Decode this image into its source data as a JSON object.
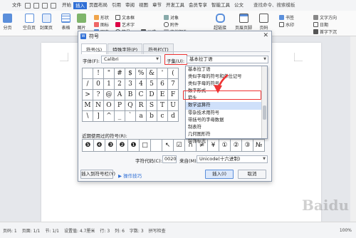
{
  "menubar": {
    "file": "文件",
    "items": [
      "开始",
      "插入",
      "页面布局",
      "引用",
      "审阅",
      "视图",
      "章节",
      "开发工具",
      "会员专享",
      "智能工具",
      "公文"
    ],
    "active_index": 1,
    "search": "查找命令、搜索模板"
  },
  "ribbon": {
    "page_break": "分页",
    "blank_page": "空白页",
    "cover": "封面页",
    "table": "表格",
    "picture": "图片",
    "shape": "形状",
    "icon": "图标",
    "chart": "图表",
    "textbox": "文本框",
    "art_text": "艺术字",
    "symbol": "符号",
    "formula": "公式",
    "object": "对象",
    "attachment": "附件",
    "doc_parts": "文档部件",
    "smart_graphic": "智能图形",
    "online_chart": "在线图表",
    "flowchart": "流程图",
    "mind_map": "思维导图",
    "more": "更多",
    "comment": "批注",
    "header_footer": "页眉页脚",
    "page_number": "页码",
    "watermark": "水印",
    "hyperlink": "超链接",
    "bookmark": "书签",
    "cross_ref": "交叉引用",
    "text_drop": "文字方向",
    "date": "日期",
    "drop_cap": "首字下沉"
  },
  "dialog": {
    "title": "符号",
    "tabs": [
      "符号(S)",
      "特殊字符(P)",
      "符号栏(T)"
    ],
    "font_label": "字体(F):",
    "font_value": "Calibri",
    "subset_label": "子集(U):",
    "subset_value": "基本拉丁语",
    "symbols": [
      "",
      "!",
      "\"",
      "#",
      "$",
      "%",
      "&",
      "'",
      "(",
      "/",
      "0",
      "1",
      "2",
      "3",
      "4",
      "5",
      "6",
      "7",
      ">",
      "?",
      "@",
      "A",
      "B",
      "C",
      "D",
      "E",
      "F",
      "M",
      "N",
      "O",
      "P",
      "Q",
      "R",
      "S",
      "T",
      "U",
      "\\",
      "]",
      "^",
      "_",
      "`",
      "a",
      "b",
      "c",
      "d"
    ],
    "recent_label": "近期使用过的符号(R):",
    "recent_symbols": [
      "❺",
      "❹",
      "❸",
      "❷",
      "❶",
      "□",
      "",
      "↖",
      "☑",
      "∩",
      "≠",
      "¥",
      "①",
      "②",
      "③",
      "№"
    ],
    "code_label": "字符代码(C):",
    "code_value": "0020",
    "from_label": "来自(M):",
    "from_value": "Unicode(十六进制)",
    "insert_to_bar": "插入到符号栏(Y)",
    "tips": "操作技巧",
    "insert": "插入(I)",
    "cancel": "取消"
  },
  "dropdown": {
    "items": [
      "基本拉丁语",
      "类似字母的符号和单位记号",
      "类似字母的符号",
      "数字形式",
      "箭头",
      "数学运算符",
      "零杂技术用符号",
      "带括号的字母数据",
      "制表符",
      "几何图形符",
      "装饰标志"
    ],
    "highlighted_index": 5
  },
  "status": {
    "page": "页码: 1",
    "pages": "页面: 1/1",
    "section": "节: 1/1",
    "setting": "设置值: 4.7厘米",
    "row": "行: 3",
    "col": "列: 6",
    "words": "字数: 3",
    "spell": "拼写检查",
    "zoom": "100%"
  },
  "colors": {
    "accent": "#2f6fd6",
    "highlight": "#e33333"
  }
}
